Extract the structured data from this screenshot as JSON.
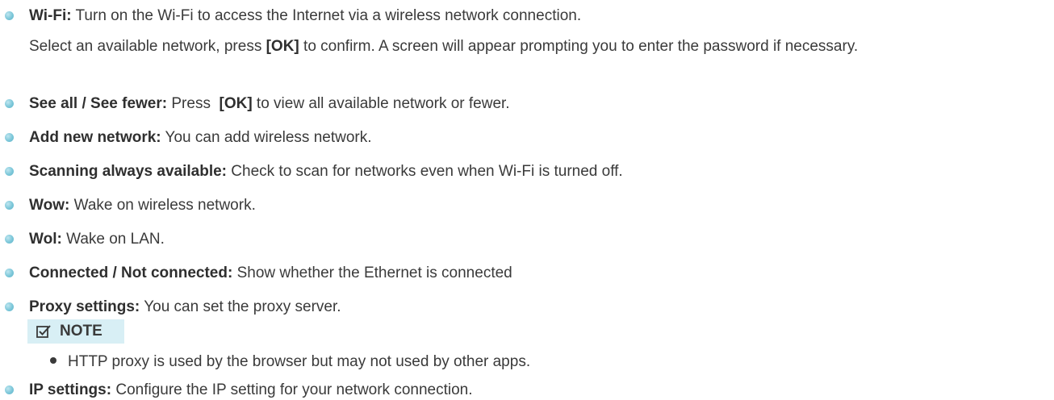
{
  "items": [
    {
      "term": "Wi-Fi:",
      "desc": " Turn on the Wi-Fi to access the Internet via a wireless network connection."
    },
    {
      "term": "See all / See fewer:",
      "pre": " Press  ",
      "key": "[OK]",
      "post": " to view all available network or fewer."
    },
    {
      "term": "Add new network:",
      "desc": " You can add wireless network."
    },
    {
      "term": "Scanning always available:",
      "desc": " Check to scan for networks even when Wi-Fi is turned off."
    },
    {
      "term": "Wow:",
      "desc": " Wake on wireless network."
    },
    {
      "term": "Wol:",
      "desc": " Wake on LAN."
    },
    {
      "term": "Connected / Not connected:",
      "desc": " Show whether the Ethernet is connected"
    },
    {
      "term": "Proxy settings:",
      "desc": " You can set the proxy server."
    },
    {
      "term": "IP settings:",
      "desc": " Configure the IP setting for your network connection."
    }
  ],
  "wifi_detail": {
    "pre": "Select an available network, press ",
    "key": "[OK]",
    "post": " to confirm. A screen will appear prompting you to enter the password if necessary."
  },
  "note": {
    "label": "NOTE",
    "icon": "note-checkbox-icon",
    "accent_color": "#d8eff5",
    "bullets": [
      "HTTP proxy is used by the browser but may not used by other apps."
    ]
  },
  "bullet_color": "#7cc7d9"
}
